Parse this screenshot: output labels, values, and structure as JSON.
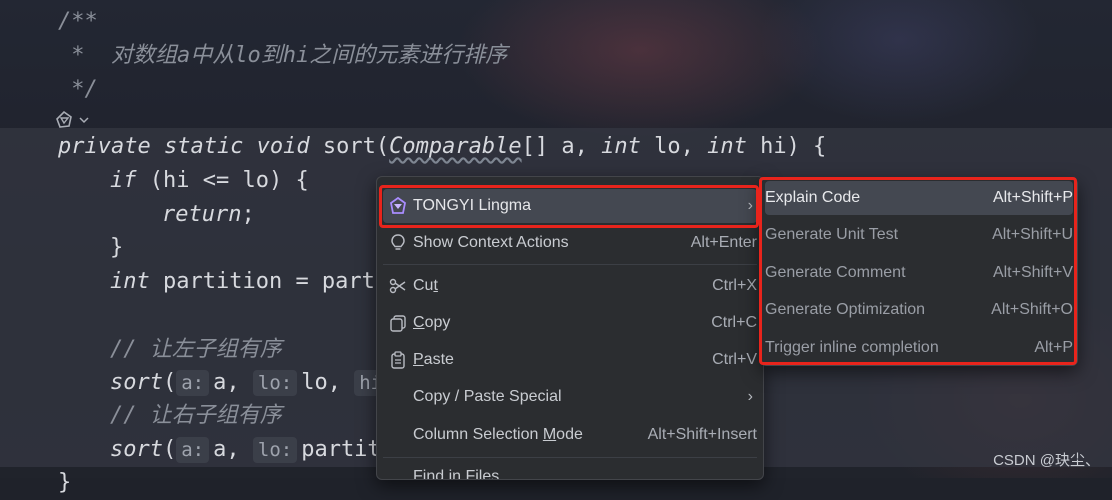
{
  "code": {
    "comment_open": "/**",
    "comment_body": " *  对数组a中从lo到hi之间的元素进行排序",
    "comment_close": " */",
    "sig": {
      "kw1": "private static void",
      "name": " sort(",
      "type": "Comparable",
      "rest1": "[] a, ",
      "kw2": "int",
      "rest2": " lo, ",
      "kw3": "int",
      "rest3": " hi) {"
    },
    "if_kw": "if",
    "if_rest": " (hi <= lo) {",
    "return_kw": "return",
    "return_rest": ";",
    "brace_close": "}",
    "int_kw": "int",
    "partition_rest": " partition = parti",
    "comment_left": "// 让左子组有序",
    "call1": {
      "fn": "sort",
      "open": "(",
      "h1": "a:",
      "a1": "a, ",
      "h2": "lo:",
      "a2": "lo, ",
      "h3": "hi:"
    },
    "comment_right": "// 让右子组有序",
    "call2": {
      "fn": "sort",
      "open": "(",
      "h1": "a:",
      "a1": "a, ",
      "h2": "lo:",
      "a2": "partiti"
    },
    "last_brace": "}"
  },
  "context_menu": {
    "items": [
      {
        "label": "TONGYI Lingma",
        "shortcut": "",
        "icon": "lingma-icon",
        "submenu": true
      },
      {
        "label": "Show Context Actions",
        "shortcut": "Alt+Enter",
        "icon": "bulb-icon"
      },
      {
        "label_pre": "Cu",
        "label_u": "t",
        "label_post": "",
        "shortcut": "Ctrl+X",
        "icon": "scissors-icon"
      },
      {
        "label_pre": "",
        "label_u": "C",
        "label_post": "opy",
        "shortcut": "Ctrl+C",
        "icon": "copy-icon"
      },
      {
        "label_pre": "",
        "label_u": "P",
        "label_post": "aste",
        "shortcut": "Ctrl+V",
        "icon": "paste-icon"
      },
      {
        "label": "Copy / Paste Special",
        "shortcut": "",
        "submenu": true
      },
      {
        "label_pre": "Column Selection ",
        "label_u": "M",
        "label_post": "ode",
        "shortcut": "Alt+Shift+Insert"
      },
      {
        "label": "Find in Files",
        "shortcut": ""
      }
    ]
  },
  "submenu": {
    "items": [
      {
        "label": "Explain Code",
        "shortcut": "Alt+Shift+P"
      },
      {
        "label": "Generate Unit Test",
        "shortcut": "Alt+Shift+U"
      },
      {
        "label": "Generate Comment",
        "shortcut": "Alt+Shift+V"
      },
      {
        "label": "Generate Optimization",
        "shortcut": "Alt+Shift+O"
      },
      {
        "label": "Trigger inline completion",
        "shortcut": "Alt+P"
      }
    ]
  },
  "watermark": "CSDN @玦尘、",
  "colors": {
    "highlight_box": "#e8241c",
    "menu_bg": "#2b2d30",
    "selected_bg": "#444851"
  }
}
